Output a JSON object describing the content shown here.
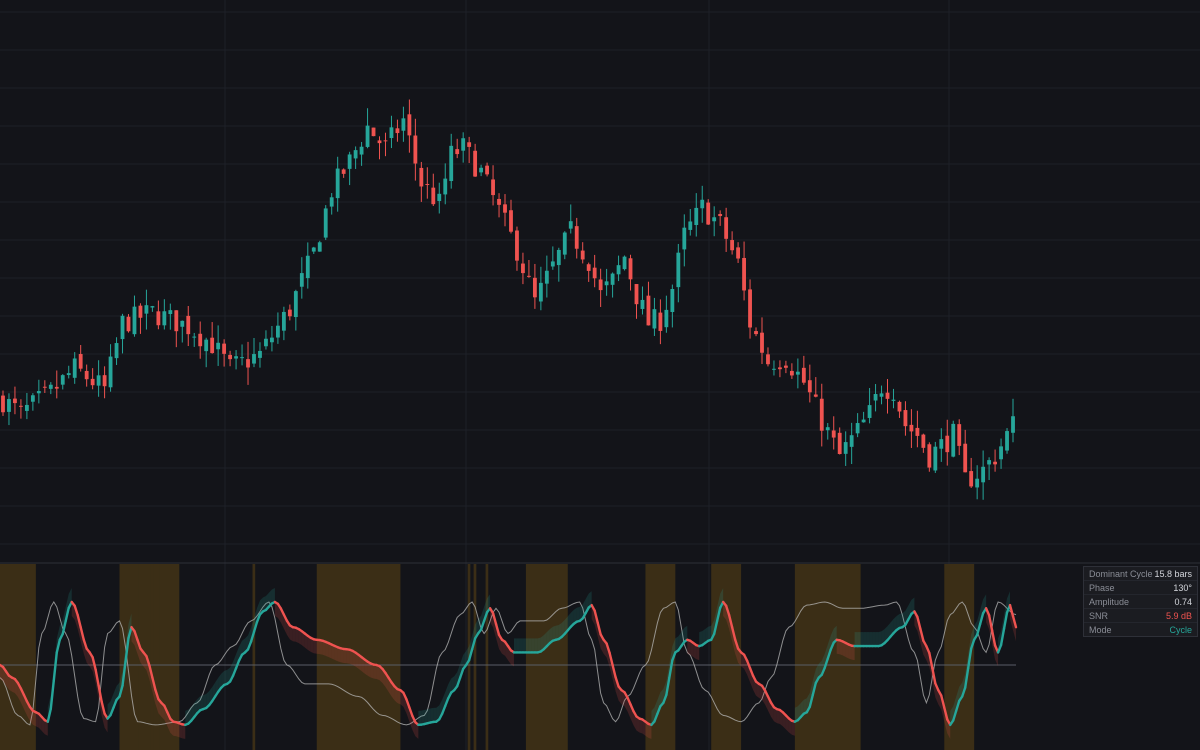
{
  "theme": {
    "background": "#131419",
    "grid": "#1e2027",
    "up": "#26a69a",
    "down": "#ef5350",
    "highlight_band": "#3b2e16",
    "reference_line": "#b8b8b8",
    "zero_line": "#5a5d66"
  },
  "info_panel": {
    "rows": [
      {
        "label": "Dominant Cycle",
        "value": "15.8 bars",
        "color": "#d4d6dc"
      },
      {
        "label": "Phase",
        "value": "130°",
        "color": "#d4d6dc"
      },
      {
        "label": "Amplitude",
        "value": "0.74",
        "color": "#d4d6dc"
      },
      {
        "label": "SNR",
        "value": "5.9 dB",
        "color": "#ef5350"
      },
      {
        "label": "Mode",
        "value": "Cycle",
        "color": "#26a69a"
      }
    ]
  },
  "chart_data": [
    {
      "type": "candlestick",
      "bar_count": 170,
      "ylim": [
        0,
        100
      ],
      "grid": true,
      "price_path_anchors": [
        [
          0,
          30
        ],
        [
          3,
          26
        ],
        [
          8,
          32
        ],
        [
          12,
          39
        ],
        [
          17,
          33
        ],
        [
          20,
          52
        ],
        [
          25,
          55
        ],
        [
          31,
          51
        ],
        [
          35,
          46
        ],
        [
          38,
          39
        ],
        [
          43,
          43
        ],
        [
          48,
          56
        ],
        [
          52,
          72
        ],
        [
          55,
          90
        ],
        [
          58,
          98
        ],
        [
          61,
          108
        ],
        [
          64,
          102
        ],
        [
          67,
          110
        ],
        [
          70,
          92
        ],
        [
          73,
          86
        ],
        [
          75,
          100
        ],
        [
          77,
          102
        ],
        [
          80,
          95
        ],
        [
          83,
          84
        ],
        [
          86,
          73
        ],
        [
          89,
          58
        ],
        [
          92,
          68
        ],
        [
          95,
          78
        ],
        [
          98,
          70
        ],
        [
          100,
          60
        ],
        [
          102,
          64
        ],
        [
          104,
          71
        ],
        [
          106,
          60
        ],
        [
          108,
          52
        ],
        [
          110,
          53
        ],
        [
          112,
          62
        ],
        [
          114,
          77
        ],
        [
          117,
          85
        ],
        [
          120,
          80
        ],
        [
          123,
          69
        ],
        [
          125,
          52
        ],
        [
          128,
          41
        ],
        [
          131,
          42
        ],
        [
          134,
          35
        ],
        [
          137,
          24
        ],
        [
          140,
          14
        ],
        [
          143,
          21
        ],
        [
          145,
          26
        ],
        [
          147,
          34
        ],
        [
          149,
          33
        ],
        [
          151,
          23
        ],
        [
          153,
          20
        ],
        [
          155,
          14
        ],
        [
          157,
          17
        ],
        [
          159,
          20
        ],
        [
          161,
          7
        ],
        [
          164,
          10
        ],
        [
          166,
          14
        ],
        [
          169,
          23
        ]
      ]
    },
    {
      "type": "line",
      "series": [
        {
          "values": "dominant-cycle oscillator, normalized -1..1"
        },
        {
          "values": "reference cycle line, normalized -1..1"
        }
      ],
      "ylim": [
        -1,
        1
      ],
      "zero_line": true,
      "shaded_bar_ranges": [
        [
          0,
          6
        ],
        [
          20,
          30
        ],
        [
          53,
          67
        ],
        [
          88,
          95
        ],
        [
          108,
          113
        ],
        [
          119,
          124
        ],
        [
          133,
          144
        ],
        [
          158,
          163
        ]
      ],
      "shaded_thin_bars": [
        23,
        25,
        26,
        42,
        78,
        79,
        81
      ]
    }
  ]
}
